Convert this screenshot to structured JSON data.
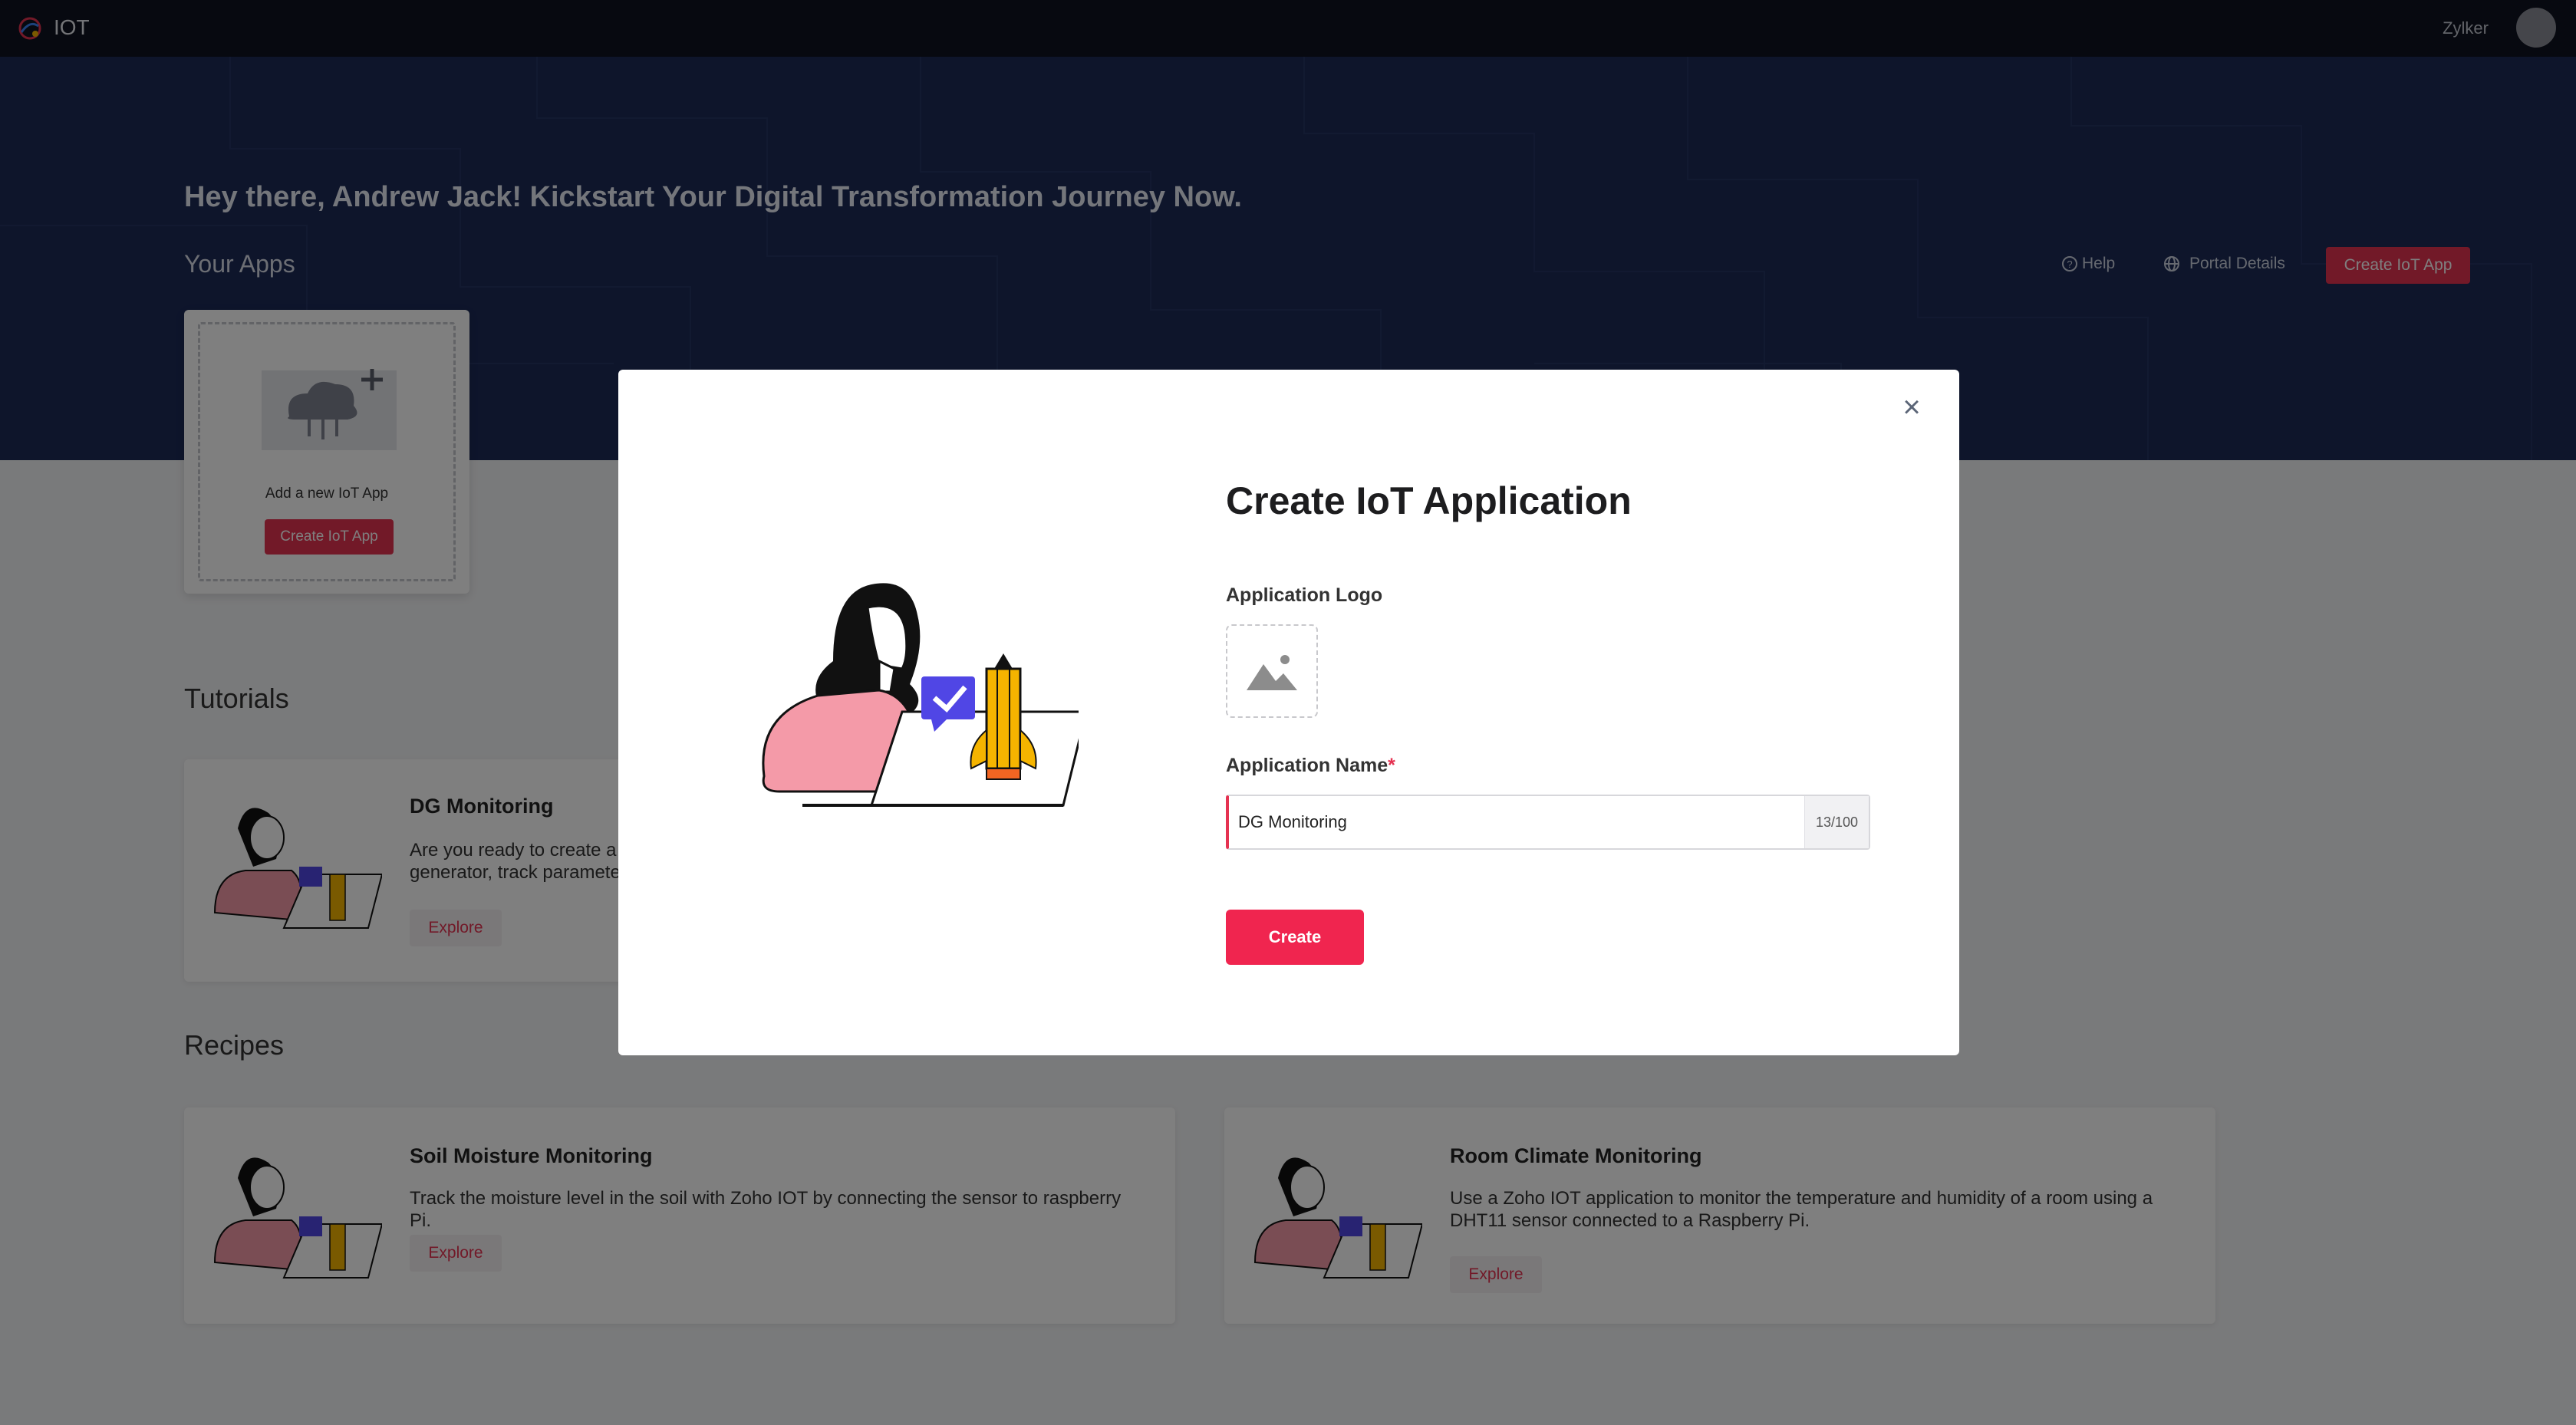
{
  "nav": {
    "app_title": "IOT",
    "org_name": "Zylker",
    "logo_icon": "zoho-iot-logo-icon",
    "chevron_icon": "chevron-down-icon",
    "avatar_icon": "user-avatar-icon"
  },
  "hero": {
    "greeting": "Hey there, Andrew Jack! Kickstart Your Digital Transformation Journey Now.",
    "your_apps": "Your Apps",
    "help": "Help",
    "portal_details": "Portal Details",
    "create_btn": "Create IoT App"
  },
  "add_card": {
    "text": "Add a new IoT App",
    "button": "Create IoT App"
  },
  "tutorials": {
    "title": "Tutorials",
    "items": [
      {
        "title": "DG Monitoring",
        "description_line1": "Are you ready to create a",
        "description_line2": "generator, track paramete",
        "button": "Explore"
      }
    ]
  },
  "recipes": {
    "title": "Recipes",
    "items": [
      {
        "title": "Soil Moisture Monitoring",
        "description": "Track the moisture level in the soil with Zoho IOT by connecting the sensor to raspberry Pi.",
        "button": "Explore"
      },
      {
        "title": "Room Climate Monitoring",
        "description": "Use a Zoho IOT application to monitor the temperature and humidity of a room using a DHT11 sensor connected to a Raspberry Pi.",
        "button": "Explore"
      }
    ]
  },
  "modal": {
    "title": "Create IoT Application",
    "logo_label": "Application Logo",
    "name_label": "Application Name",
    "required_mark": "*",
    "name_value": "DG Monitoring",
    "name_counter": "13/100",
    "create_btn": "Create",
    "close_icon": "close-icon",
    "image_placeholder_icon": "image-placeholder-icon"
  },
  "colors": {
    "accent": "#e53251",
    "hero_bg": "#1c2a57",
    "topbar_bg": "#0f1320"
  }
}
